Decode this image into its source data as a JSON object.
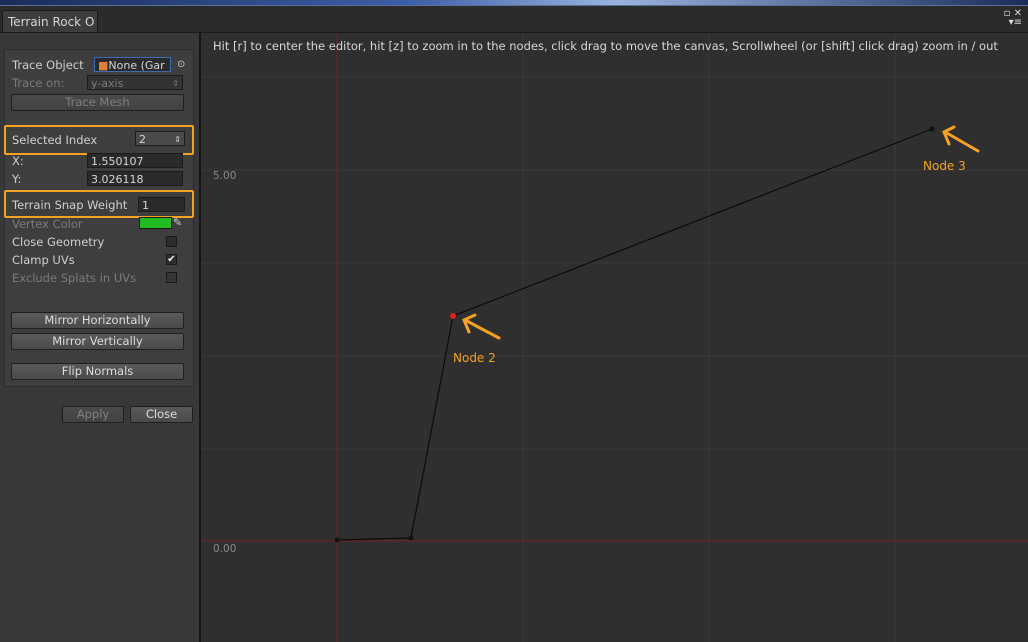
{
  "window": {
    "tab_title": "Terrain Rock O",
    "maximize_icon": "maximize-icon",
    "close_icon": "close-icon",
    "menu_icon": "menu-icon"
  },
  "panel": {
    "trace_object_label": "Trace Object",
    "trace_object_value": "None (Gar",
    "trace_on_label": "Trace on:",
    "trace_on_value": "y-axis",
    "trace_mesh_button": "Trace Mesh",
    "selected_index_label": "Selected Index",
    "selected_index_value": "2",
    "x_label": "X:",
    "x_value": "1.550107",
    "y_label": "Y:",
    "y_value": "3.026118",
    "terrain_snap_weight_label": "Terrain Snap Weight",
    "terrain_snap_weight_value": "1",
    "vertex_color_label": "Vertex Color",
    "vertex_color": "#22bb22",
    "close_geometry_label": "Close Geometry",
    "close_geometry_checked": false,
    "clamp_uvs_label": "Clamp UVs",
    "clamp_uvs_checked": true,
    "exclude_splats_label": "Exclude Splats in UVs",
    "exclude_splats_checked": false,
    "mirror_horizontally_button": "Mirror Horizontally",
    "mirror_vertically_button": "Mirror Vertically",
    "flip_normals_button": "Flip Normals",
    "apply_button": "Apply",
    "close_button": "Close"
  },
  "canvas": {
    "hint": "Hit [r] to center the editor, hit [z] to zoom in to the nodes, click drag to move the canvas, Scrollwheel (or [shift] click drag) zoom in / out",
    "y_axis_labels": [
      "5.00",
      "0.00"
    ],
    "annotations": [
      "Node 2",
      "Node 3"
    ],
    "highlight_color": "#f5a123",
    "selected_node_color": "#e02020"
  }
}
